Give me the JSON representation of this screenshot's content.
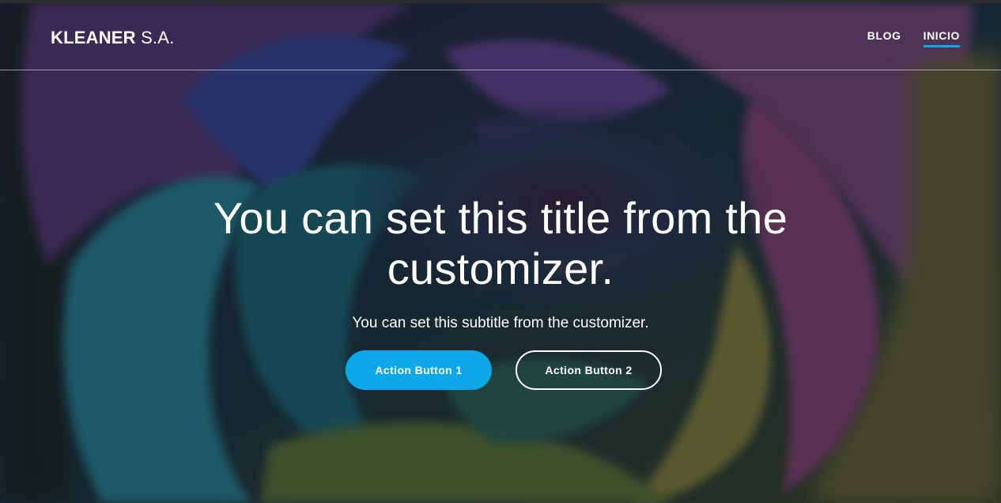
{
  "brand": {
    "name_bold": "KLEANER",
    "name_light": "S.A."
  },
  "nav": {
    "items": [
      {
        "label": "BLOG",
        "active": false
      },
      {
        "label": "INICIO",
        "active": true
      }
    ],
    "active_color": "#0fa8e8"
  },
  "hero": {
    "title": "You can set this title from the customizer.",
    "subtitle": "You can set this subtitle from the customizer.",
    "background": "rainbow-rose-photo",
    "primary_button": "Action Button 1",
    "secondary_button": "Action Button 2",
    "primary_color": "#0ea8ea"
  }
}
